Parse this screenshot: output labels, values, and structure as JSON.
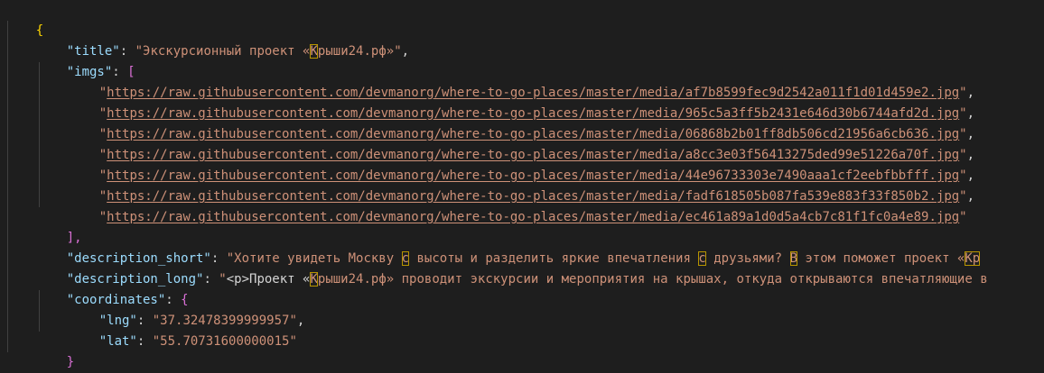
{
  "brackets": {
    "root_open": "{",
    "root_close": "}",
    "imgs_open": "[",
    "imgs_close": "],",
    "coords_open": "{",
    "coords_close": "}"
  },
  "keys": {
    "title": "\"title\"",
    "imgs": "\"imgs\"",
    "description_short": "\"description_short\"",
    "description_long": "\"description_long\"",
    "coordinates": "\"coordinates\"",
    "lng": "\"lng\"",
    "lat": "\"lat\""
  },
  "values": {
    "title_a": "\"Экскурсионный проект «",
    "title_b": "К",
    "title_c": "рыши24.рф»\"",
    "description_short_a": "\"Хотите увидеть Москву ",
    "description_short_b": "с",
    "description_short_c": " высоты и разделить яркие впечатления ",
    "description_short_d": "с",
    "description_short_e": " друзьями? ",
    "description_short_f": "В",
    "description_short_g": " этом поможет проект «",
    "description_short_h": "Кр",
    "description_long_a": "\"",
    "description_long_b": "<p>Проект «",
    "description_long_c": "К",
    "description_long_d": "рыши24.рф» проводит экскурсии и мероприятия на крышах, откуда открываются впечатляющие в",
    "lng": "\"37.32478399999957\"",
    "lat": "\"55.70731600000015\""
  },
  "imgs": [
    "https://raw.githubusercontent.com/devmanorg/where-to-go-places/master/media/af7b8599fec9d2542a011f1d01d459e2.jpg",
    "https://raw.githubusercontent.com/devmanorg/where-to-go-places/master/media/965c5a3ff5b2431e646d30b6744afd2d.jpg",
    "https://raw.githubusercontent.com/devmanorg/where-to-go-places/master/media/06868b2b01ff8db506cd21956a6cb636.jpg",
    "https://raw.githubusercontent.com/devmanorg/where-to-go-places/master/media/a8cc3e03f56413275ded99e51226a70f.jpg",
    "https://raw.githubusercontent.com/devmanorg/where-to-go-places/master/media/44e96733303e7490aaa1cf2eebfbbfff.jpg",
    "https://raw.githubusercontent.com/devmanorg/where-to-go-places/master/media/fadf618505b087fa539e883f33f850b2.jpg",
    "https://raw.githubusercontent.com/devmanorg/where-to-go-places/master/media/ec461a89a1d0d5a4cb7c81f1fc0a4e89.jpg"
  ],
  "punct": {
    "colon": ": ",
    "comma": ",",
    "quote": "\""
  },
  "colors": {
    "background": "#1e1e1e",
    "key": "#9cdcfe",
    "string": "#ce9178",
    "bracket_level1": "#ffd700",
    "bracket_level2": "#da70d6",
    "bracket_level3": "#179fff",
    "unicode_highlight": "#b89500"
  }
}
